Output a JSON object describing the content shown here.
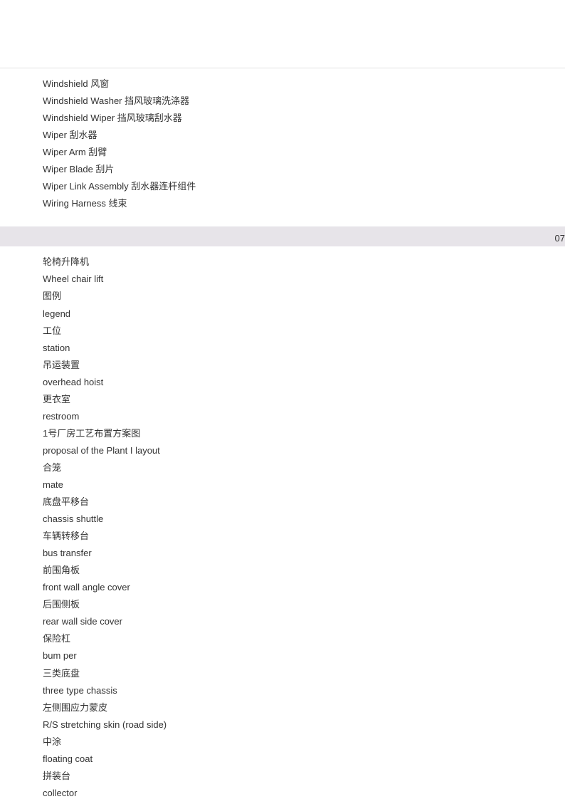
{
  "top_section": [
    "Windshield  风窗",
    "Windshield  Washer  挡风玻璃洗涤器",
    "Windshield  Wiper  挡风玻璃刮水器",
    "Wiper  刮水器",
    "Wiper Arm  刮臂",
    "Wiper Blade  刮片",
    "Wiper Link  Assembly  刮水器连杆组件",
    "Wiring Harness  线束"
  ],
  "divider": {
    "page_num": "07"
  },
  "bottom_section": [
    "轮椅升降机",
    "Wheel chair lift",
    "图例",
    "legend",
    "工位",
    "station",
    "吊运装置",
    "overhead hoist",
    "更衣室",
    "restroom",
    "1号厂房工艺布置方案图",
    "proposal of the Plant I layout",
    "合笼",
    "mate",
    "底盘平移台",
    "chassis shuttle",
    "车辆转移台",
    "bus transfer",
    "前围角板",
    "front wall angle cover",
    "后围侧板",
    "rear wall side cover",
    "保险杠",
    "bum per",
    "三类底盘",
    "three type chassis",
    "左侧围应力蒙皮",
    "R/S stretching skin (road side)",
    "中涂",
    "floating coat",
    "拼装台",
    "collector"
  ]
}
